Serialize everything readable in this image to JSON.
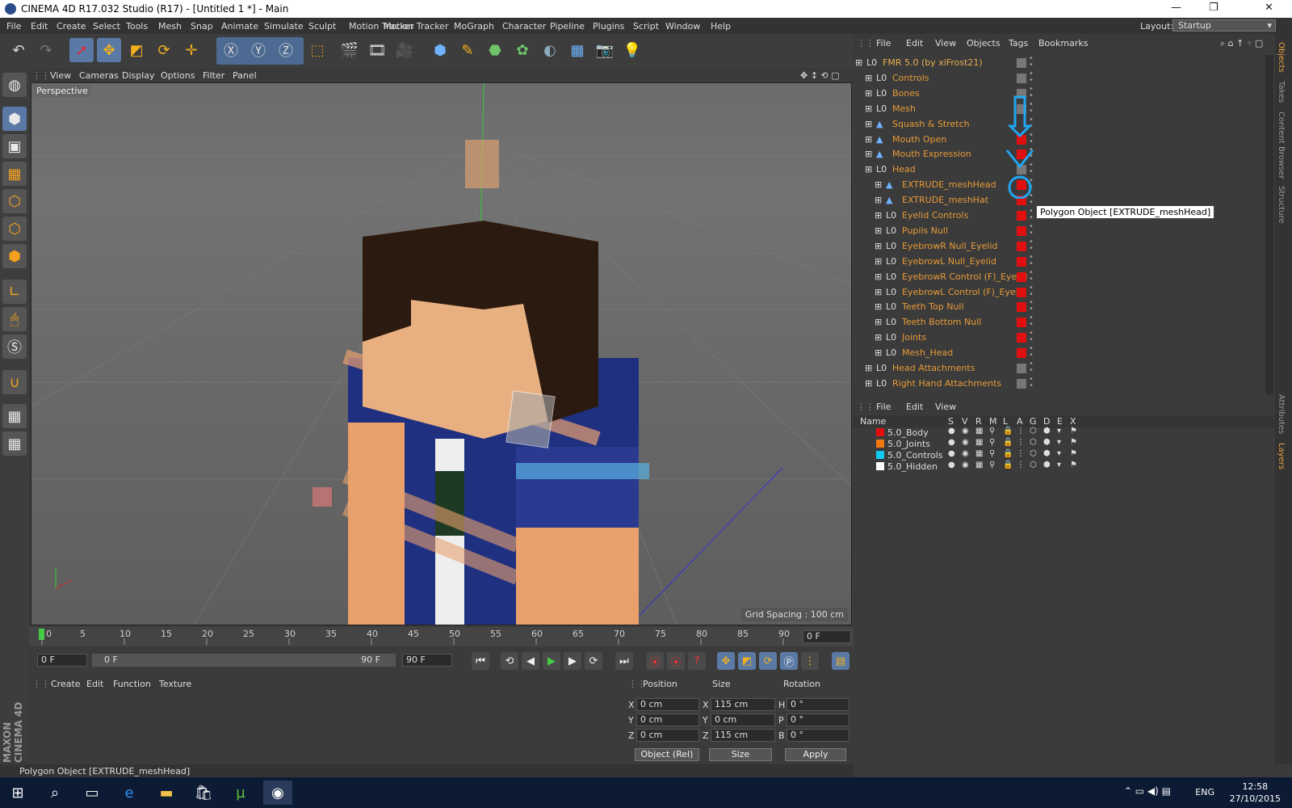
{
  "window": {
    "title": "CINEMA 4D R17.032 Studio (R17) - [Untitled 1 *] - Main",
    "controls": [
      "—",
      "❐",
      "✕"
    ]
  },
  "menu": {
    "items": [
      "File",
      "Edit",
      "Create",
      "Select",
      "Tools",
      "Mesh",
      "Snap",
      "Animate",
      "Simulate",
      "Sculpt",
      "Motion Tracker",
      "MoGraph",
      "Character",
      "Pipeline",
      "Plugins",
      "Script",
      "Window",
      "Help"
    ],
    "layout_label": "Layout:",
    "layout_value": "Startup"
  },
  "viewport": {
    "menu": [
      "View",
      "Cameras",
      "Display",
      "Options",
      "Filter",
      "Panel"
    ],
    "label": "Perspective",
    "grid_spacing": "Grid Spacing : 100 cm"
  },
  "timeline": {
    "ticks": [
      "0",
      "5",
      "10",
      "15",
      "20",
      "25",
      "30",
      "35",
      "40",
      "45",
      "50",
      "55",
      "60",
      "65",
      "70",
      "75",
      "80",
      "85",
      "90"
    ],
    "current_frame": "0 F",
    "start_field": "0 F",
    "slider_left": "0 F",
    "slider_right": "90 F",
    "end_field": "90 F"
  },
  "material_manager": {
    "menu": [
      "Create",
      "Edit",
      "Function",
      "Texture"
    ]
  },
  "coordinates": {
    "headers": [
      "Position",
      "Size",
      "Rotation"
    ],
    "rows": [
      {
        "axis": "X",
        "pos": "0 cm",
        "saxis": "X",
        "size": "115 cm",
        "raxis": "H",
        "rot": "0 °"
      },
      {
        "axis": "Y",
        "pos": "0 cm",
        "saxis": "Y",
        "size": "0 cm",
        "raxis": "P",
        "rot": "0 °"
      },
      {
        "axis": "Z",
        "pos": "0 cm",
        "saxis": "Z",
        "size": "115 cm",
        "raxis": "B",
        "rot": "0 °"
      }
    ],
    "mode": "Object (Rel)",
    "size_mode": "Size",
    "apply": "Apply"
  },
  "status": "Polygon Object [EXTRUDE_meshHead]",
  "objects": {
    "menu": [
      "File",
      "Edit",
      "View",
      "Objects",
      "Tags",
      "Bookmarks"
    ],
    "items": [
      {
        "name": "FMR 5.0 (by xiFrost21)",
        "indent": 0,
        "icon": "null-icon",
        "flag": "gray"
      },
      {
        "name": "Controls",
        "indent": 1,
        "icon": "null-icon",
        "flag": "gray"
      },
      {
        "name": "Bones",
        "indent": 1,
        "icon": "null-icon",
        "flag": "gray"
      },
      {
        "name": "Mesh",
        "indent": 1,
        "icon": "null-icon",
        "flag": "gray"
      },
      {
        "name": "Squash & Stretch",
        "indent": 1,
        "icon": "deformer-icon",
        "flag": "none"
      },
      {
        "name": "Mouth Open",
        "indent": 1,
        "icon": "deformer-icon",
        "flag": "red"
      },
      {
        "name": "Mouth Expression",
        "indent": 1,
        "icon": "deformer-icon",
        "flag": "red"
      },
      {
        "name": "Head",
        "indent": 1,
        "icon": "null-icon",
        "flag": "gray"
      },
      {
        "name": "EXTRUDE_meshHead",
        "indent": 2,
        "icon": "polygon-icon",
        "flag": "red"
      },
      {
        "name": "EXTRUDE_meshHat",
        "indent": 2,
        "icon": "polygon-icon",
        "flag": "red"
      },
      {
        "name": "Eyelid Controls",
        "indent": 2,
        "icon": "null-icon",
        "flag": "red"
      },
      {
        "name": "Pupils Null",
        "indent": 2,
        "icon": "null-icon",
        "flag": "red"
      },
      {
        "name": "EyebrowR Null_Eyelid",
        "indent": 2,
        "icon": "null-icon",
        "flag": "red"
      },
      {
        "name": "EyebrowL Null_Eyelid",
        "indent": 2,
        "icon": "null-icon",
        "flag": "red"
      },
      {
        "name": "EyebrowR Control (F)_Eyelid",
        "indent": 2,
        "icon": "null-icon",
        "flag": "red"
      },
      {
        "name": "EyebrowL Control (F)_Eyelid",
        "indent": 2,
        "icon": "null-icon",
        "flag": "red"
      },
      {
        "name": "Teeth Top Null",
        "indent": 2,
        "icon": "null-icon",
        "flag": "red"
      },
      {
        "name": "Teeth Bottom Null",
        "indent": 2,
        "icon": "null-icon",
        "flag": "red"
      },
      {
        "name": "Joints",
        "indent": 2,
        "icon": "null-icon",
        "flag": "red"
      },
      {
        "name": "Mesh_Head",
        "indent": 2,
        "icon": "null-icon",
        "flag": "red"
      },
      {
        "name": "Head Attachments",
        "indent": 1,
        "icon": "null-icon",
        "flag": "gray"
      },
      {
        "name": "Right Hand Attachments",
        "indent": 1,
        "icon": "null-icon",
        "flag": "gray"
      }
    ],
    "tooltip": "Polygon Object [EXTRUDE_meshHead]"
  },
  "layers": {
    "menu": [
      "File",
      "Edit",
      "View"
    ],
    "columns": [
      "Name",
      "S",
      "V",
      "R",
      "M",
      "L",
      "A",
      "G",
      "D",
      "E",
      "X"
    ],
    "items": [
      {
        "name": "5.0_Body",
        "color": "#e01010"
      },
      {
        "name": "5.0_Joints",
        "color": "#f07810"
      },
      {
        "name": "5.0_Controls",
        "color": "#10c8f0"
      },
      {
        "name": "5.0_Hidden",
        "color": "#ffffff"
      }
    ]
  },
  "right_tabs": [
    "Objects",
    "Takes",
    "Content Browser",
    "Structure",
    "Attributes",
    "Layers"
  ],
  "taskbar": {
    "lang": "ENG",
    "time": "12:58",
    "date": "27/10/2015"
  },
  "brand": "MAXON CINEMA 4D"
}
